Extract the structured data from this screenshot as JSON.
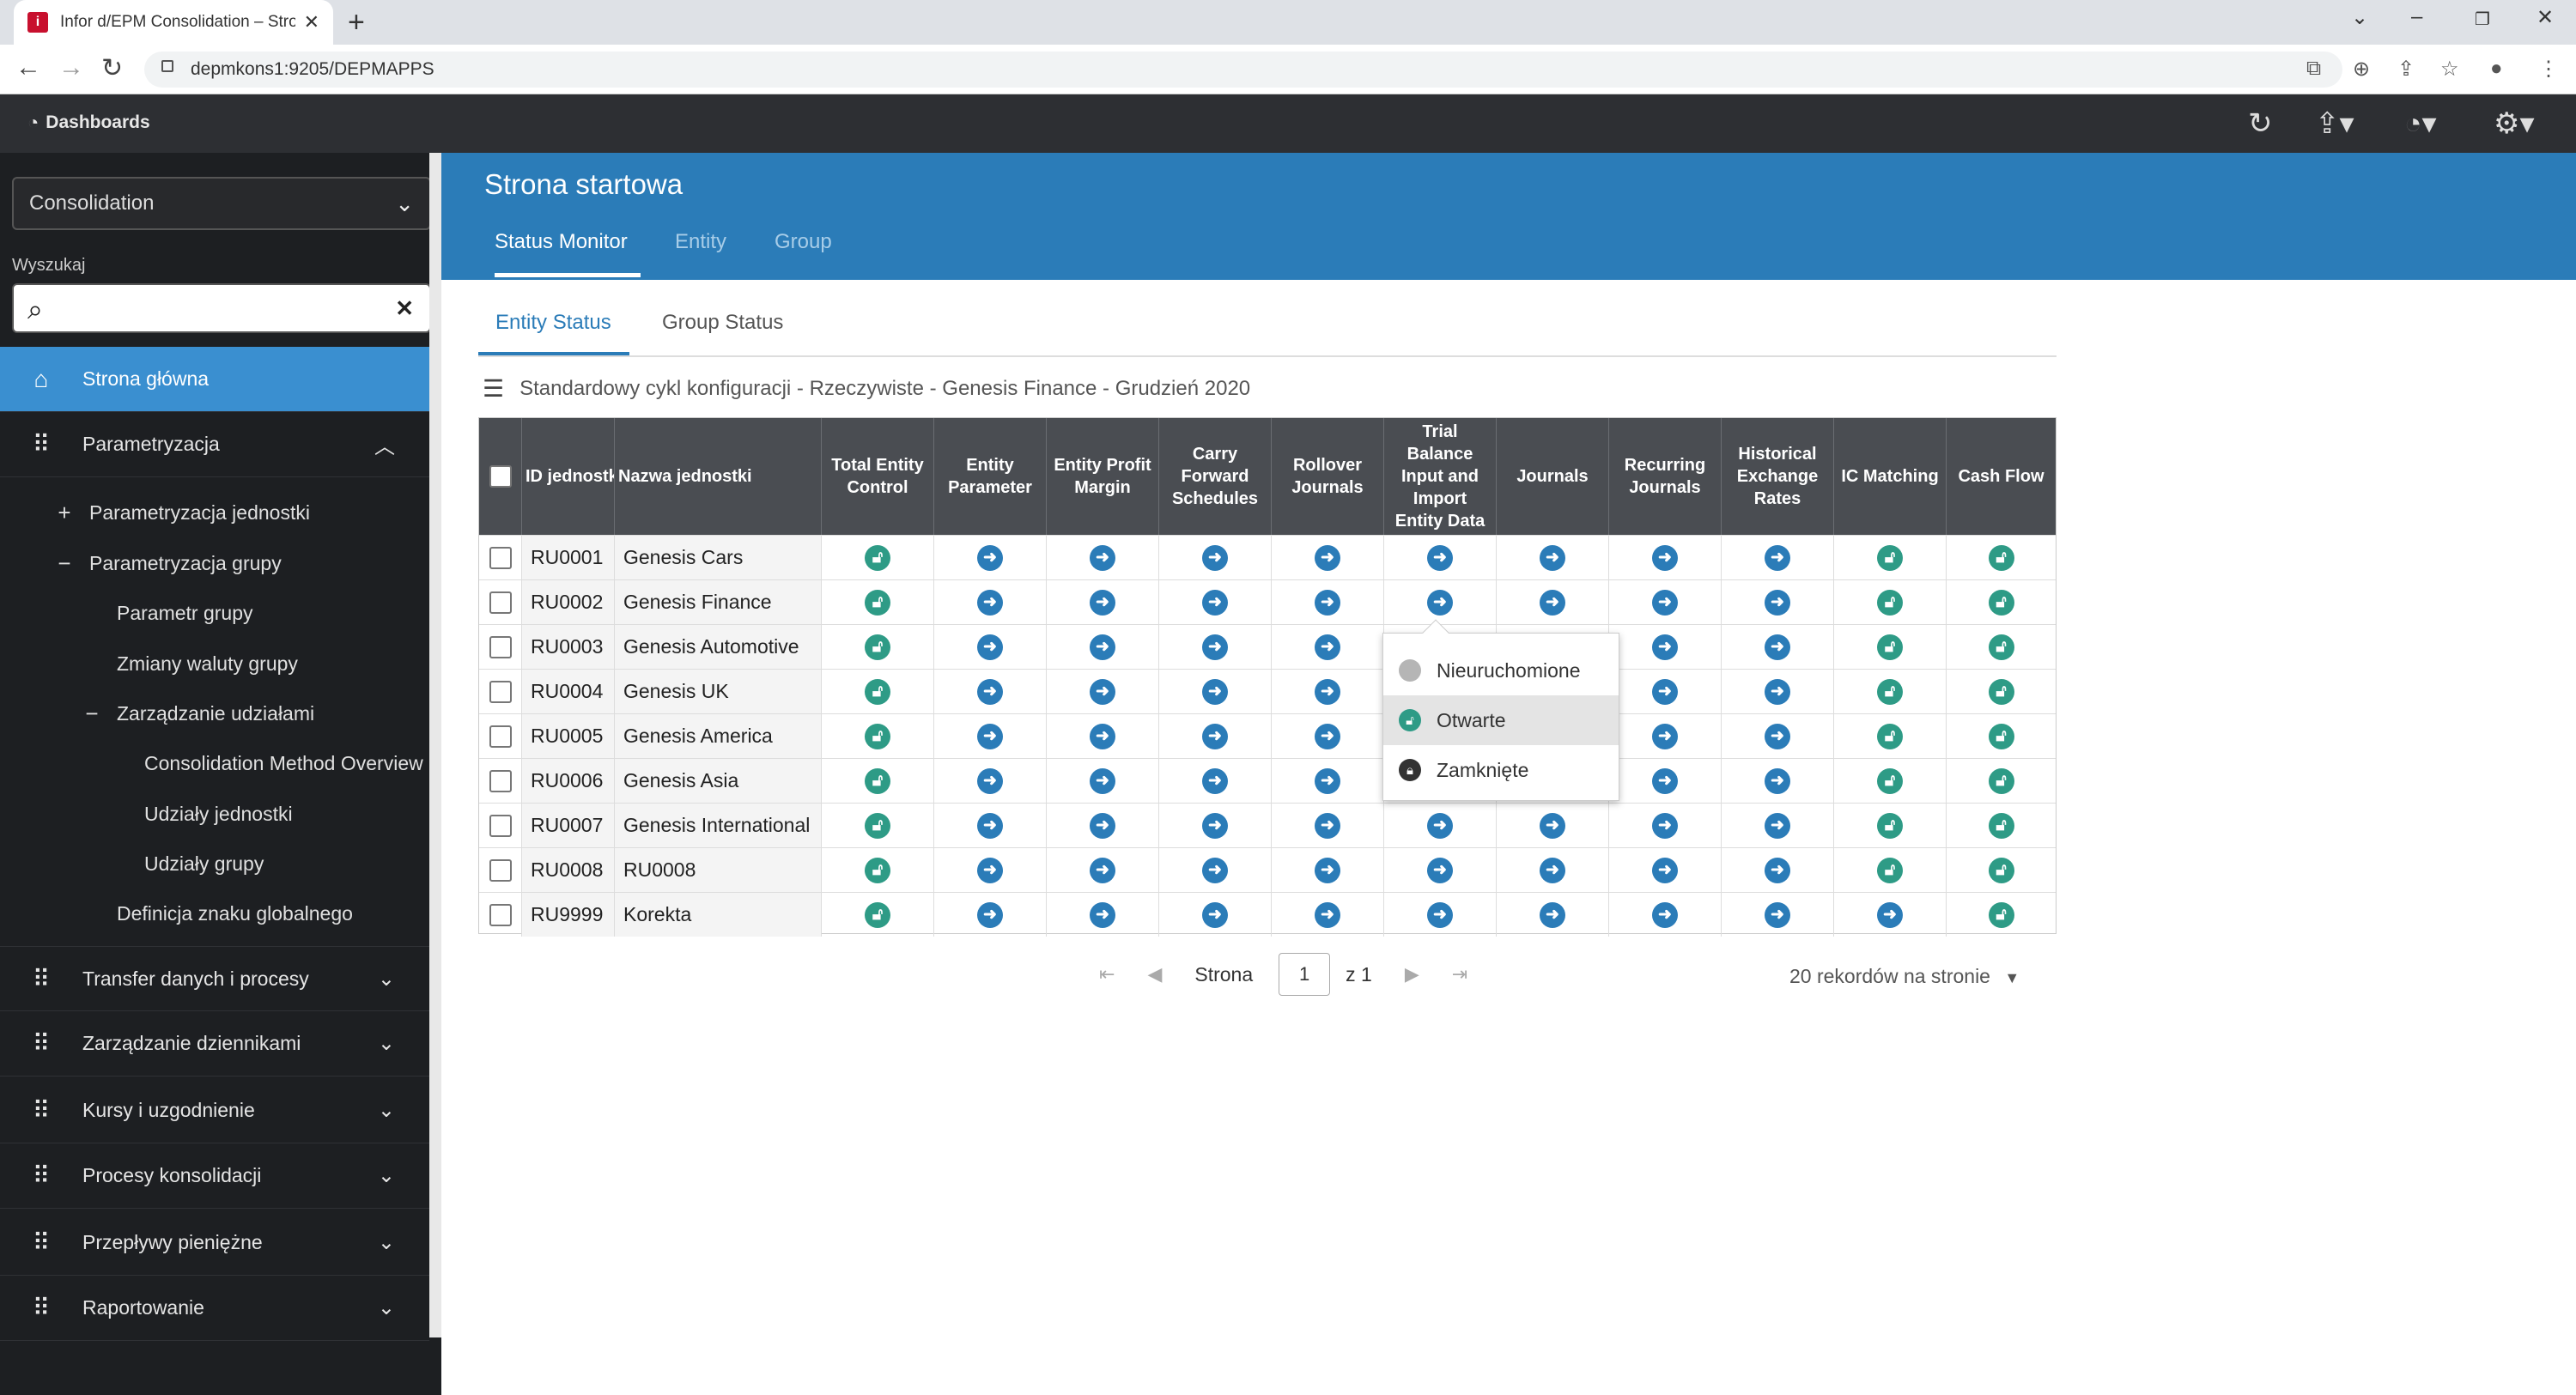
{
  "browser": {
    "tab_title": "Infor d/EPM Consolidation – Strona",
    "url": "depmkons1:9205/DEPMAPPS"
  },
  "appbar": {
    "dashboards_label": "Dashboards"
  },
  "sidebar": {
    "app_select": "Consolidation",
    "search_label": "Wyszukaj",
    "search_value": "",
    "home": "Strona główna",
    "param": "Parametryzacja",
    "sub": {
      "param_jedn": "Parametryzacja jednostki",
      "param_grupy": "Parametryzacja grupy",
      "parametr_grupy": "Parametr grupy",
      "zmiany_waluty": "Zmiany waluty grupy",
      "zarz_udzialami": "Zarządzanie udziałami",
      "cons_method": "Consolidation Method Overview",
      "udzialy_jedn": "Udziały jednostki",
      "udzialy_grupy": "Udziały grupy",
      "definicja": "Definicja znaku globalnego"
    },
    "transfer": "Transfer danych i procesy",
    "dzienniki": "Zarządzanie dziennikami",
    "kursy": "Kursy i uzgodnienie",
    "procesy": "Procesy konsolidacji",
    "przeplywy": "Przepływy pieniężne",
    "raport": "Raportowanie"
  },
  "header": {
    "title": "Strona startowa",
    "tabs": {
      "status": "Status Monitor",
      "entity": "Entity",
      "group": "Group"
    }
  },
  "subtabs": {
    "entity": "Entity Status",
    "group": "Group Status"
  },
  "context": "Standardowy cykl konfiguracji - Rzeczywiste - Genesis Finance - Grudzień 2020",
  "columns": {
    "id": "ID jednostki",
    "name": "Nazwa jednostki",
    "c1": "Total Entity Control",
    "c2": "Entity Parameter",
    "c3": "Entity Profit Margin",
    "c4": "Carry Forward Schedules",
    "c5": "Rollover Journals",
    "c6": "Trial Balance Input and Import Entity Data",
    "c7": "Journals",
    "c8": "Recurring Journals",
    "c9": "Historical Exchange Rates",
    "c10": "IC Matching",
    "c11": "Cash Flow"
  },
  "rows": [
    {
      "id": "RU0001",
      "name": "Genesis Cars",
      "status": [
        "open",
        "arrow",
        "arrow",
        "arrow",
        "arrow",
        "arrow",
        "arrow",
        "arrow",
        "arrow",
        "open",
        "open"
      ]
    },
    {
      "id": "RU0002",
      "name": "Genesis Finance",
      "status": [
        "open",
        "arrow",
        "arrow",
        "arrow",
        "arrow",
        "arrow",
        "arrow",
        "arrow",
        "arrow",
        "open",
        "open"
      ]
    },
    {
      "id": "RU0003",
      "name": "Genesis Automotive",
      "status": [
        "open",
        "arrow",
        "arrow",
        "arrow",
        "arrow",
        "",
        "",
        "arrow",
        "arrow",
        "open",
        "open"
      ]
    },
    {
      "id": "RU0004",
      "name": "Genesis UK",
      "status": [
        "open",
        "arrow",
        "arrow",
        "arrow",
        "arrow",
        "",
        "",
        "arrow",
        "arrow",
        "open",
        "open"
      ]
    },
    {
      "id": "RU0005",
      "name": "Genesis America",
      "status": [
        "open",
        "arrow",
        "arrow",
        "arrow",
        "arrow",
        "",
        "",
        "arrow",
        "arrow",
        "open",
        "open"
      ]
    },
    {
      "id": "RU0006",
      "name": "Genesis Asia",
      "status": [
        "open",
        "arrow",
        "arrow",
        "arrow",
        "arrow",
        "",
        "",
        "arrow",
        "arrow",
        "open",
        "open"
      ]
    },
    {
      "id": "RU0007",
      "name": "Genesis International",
      "status": [
        "open",
        "arrow",
        "arrow",
        "arrow",
        "arrow",
        "arrow",
        "arrow",
        "arrow",
        "arrow",
        "open",
        "open"
      ]
    },
    {
      "id": "RU0008",
      "name": "RU0008",
      "status": [
        "open",
        "arrow",
        "arrow",
        "arrow",
        "arrow",
        "arrow",
        "arrow",
        "arrow",
        "arrow",
        "open",
        "open"
      ]
    },
    {
      "id": "RU9999",
      "name": "Korekta",
      "status": [
        "open",
        "arrow",
        "arrow",
        "arrow",
        "arrow",
        "arrow",
        "arrow",
        "arrow",
        "arrow",
        "arrow",
        "open"
      ]
    }
  ],
  "popup": {
    "not_started": "Nieuruchomione",
    "open": "Otwarte",
    "closed": "Zamknięte"
  },
  "pager": {
    "page_label": "Strona",
    "page": "1",
    "of": "z 1",
    "per_page": "20 rekordów na stronie"
  },
  "colors": {
    "accent": "#2b7cb8",
    "open": "#2e9b86",
    "sidebar": "#1d1f22",
    "header_cell": "#4a4d52"
  }
}
